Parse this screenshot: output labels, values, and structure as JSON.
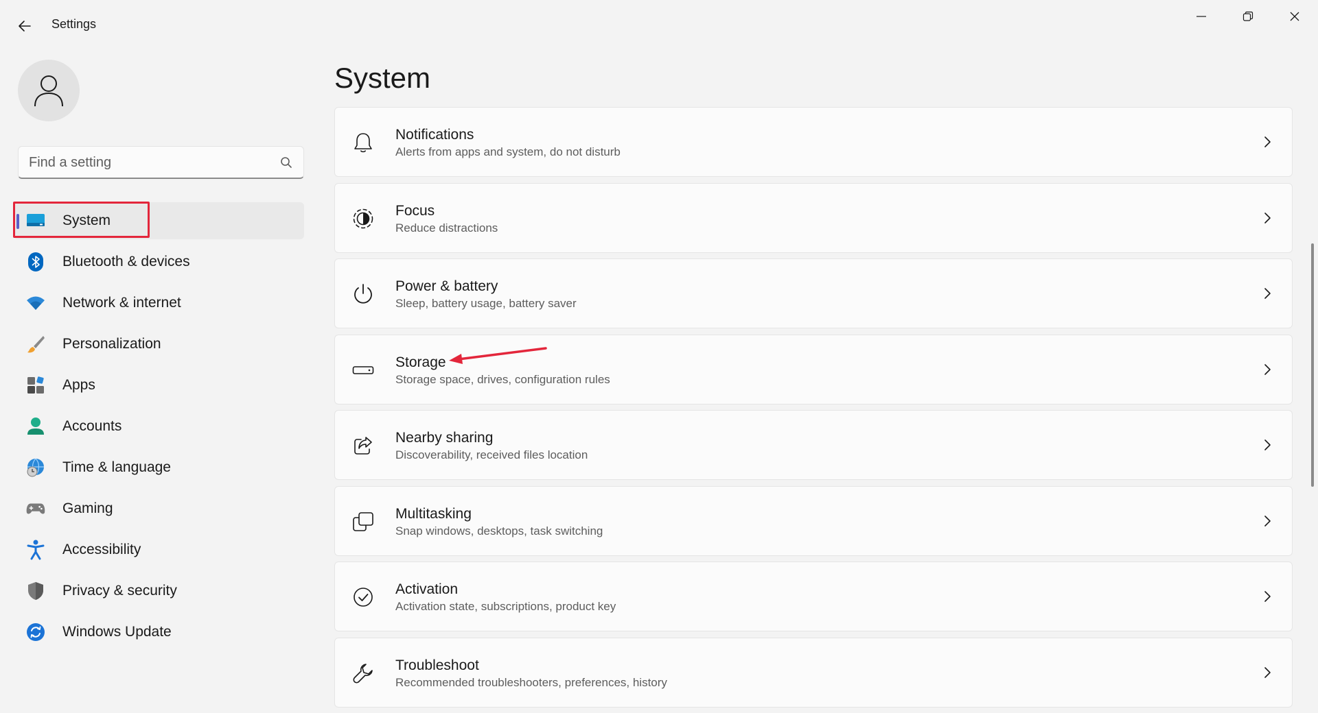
{
  "window": {
    "title": "Settings"
  },
  "sidebar": {
    "search": {
      "placeholder": "Find a setting",
      "value": ""
    },
    "items": [
      {
        "label": "System",
        "icon": "system-icon",
        "selected": true
      },
      {
        "label": "Bluetooth & devices",
        "icon": "bluetooth-icon"
      },
      {
        "label": "Network & internet",
        "icon": "wifi-icon"
      },
      {
        "label": "Personalization",
        "icon": "brush-icon"
      },
      {
        "label": "Apps",
        "icon": "apps-icon"
      },
      {
        "label": "Accounts",
        "icon": "accounts-icon"
      },
      {
        "label": "Time & language",
        "icon": "globe-clock-icon"
      },
      {
        "label": "Gaming",
        "icon": "gamepad-icon"
      },
      {
        "label": "Accessibility",
        "icon": "accessibility-icon"
      },
      {
        "label": "Privacy & security",
        "icon": "shield-icon"
      },
      {
        "label": "Windows Update",
        "icon": "update-icon"
      }
    ]
  },
  "main": {
    "title": "System",
    "cards": [
      {
        "title": "Notifications",
        "desc": "Alerts from apps and system, do not disturb",
        "icon": "bell-icon"
      },
      {
        "title": "Focus",
        "desc": "Reduce distractions",
        "icon": "focus-icon"
      },
      {
        "title": "Power & battery",
        "desc": "Sleep, battery usage, battery saver",
        "icon": "power-icon"
      },
      {
        "title": "Storage",
        "desc": "Storage space, drives, configuration rules",
        "icon": "storage-icon"
      },
      {
        "title": "Nearby sharing",
        "desc": "Discoverability, received files location",
        "icon": "share-icon"
      },
      {
        "title": "Multitasking",
        "desc": "Snap windows, desktops, task switching",
        "icon": "multitasking-icon"
      },
      {
        "title": "Activation",
        "desc": "Activation state, subscriptions, product key",
        "icon": "check-circle-icon"
      },
      {
        "title": "Troubleshoot",
        "desc": "Recommended troubleshooters, preferences, history",
        "icon": "wrench-icon"
      }
    ]
  },
  "colors": {
    "accent": "#5b5fc7",
    "annotation": "#e3263b",
    "background": "#f3f3f3",
    "card": "#fbfbfb"
  }
}
